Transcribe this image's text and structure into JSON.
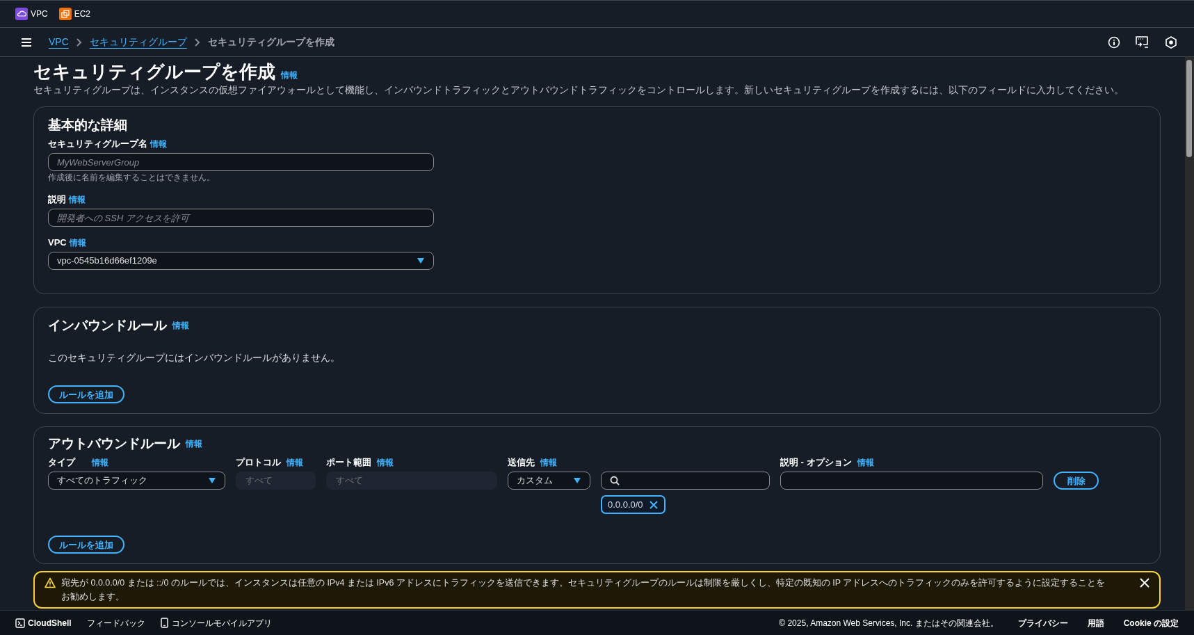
{
  "top_nav": {
    "services": [
      {
        "label": "VPC",
        "color": "#7d4cdb"
      },
      {
        "label": "EC2",
        "color": "#ed7100"
      }
    ]
  },
  "breadcrumbs": [
    {
      "label": "VPC",
      "kind": "link"
    },
    {
      "label": "セキュリティグループ",
      "kind": "link"
    },
    {
      "label": "セキュリティグループを作成",
      "kind": "current"
    }
  ],
  "header": {
    "title": "セキュリティグループを作成",
    "info": "情報",
    "description": "セキュリティグループは、インスタンスの仮想ファイアウォールとして機能し、インバウンドトラフィックとアウトバウンドトラフィックをコントロールします。新しいセキュリティグループを作成するには、以下のフィールドに入力してください。"
  },
  "basic_details": {
    "title": "基本的な詳細",
    "fields": [
      {
        "kind": "text",
        "label": "セキュリティグループ名",
        "info": "情報",
        "placeholder": "MyWebServerGroup",
        "hint": "作成後に名前を編集することはできません。"
      },
      {
        "kind": "text",
        "label": "説明",
        "info": "情報",
        "placeholder": "開発者への SSH アクセスを許可"
      },
      {
        "kind": "select",
        "label": "VPC",
        "info": "情報",
        "value": "vpc-0545b16d66ef1209e"
      }
    ]
  },
  "inbound_rules": {
    "title": "インバウンドルール",
    "info": "情報",
    "empty_message": "このセキュリティグループにはインバウンドルールがありません。",
    "add_button": "ルールを追加"
  },
  "outbound_rules": {
    "title": "アウトバウンドルール",
    "info": "情報",
    "columns": [
      {
        "label": "タイプ",
        "info": "情報"
      },
      {
        "label": "プロトコル",
        "info": "情報"
      },
      {
        "label": "ポート範囲",
        "info": "情報"
      },
      {
        "label": "送信先",
        "info": "情報"
      },
      {
        "label": "説明 - オプション",
        "info": "情報"
      }
    ],
    "rows": [
      {
        "type": "すべてのトラフィック",
        "protocol": {
          "value": "すべて",
          "disabled": true
        },
        "port_range": {
          "value": "すべて",
          "disabled": true
        },
        "destination": "カスタム",
        "destination_tokens": [
          "0.0.0.0/0"
        ],
        "delete_button": "削除"
      }
    ],
    "add_button": "ルールを追加"
  },
  "warning": {
    "message": "宛先が 0.0.0.0/0 または ::/0 のルールでは、インスタンスは任意の IPv4 または IPv6 アドレスにトラフィックを送信できます。セキュリティグループのルールは制限を厳しくし、特定の既知の IP アドレスへのトラフィックのみを許可するように設定することをお勧めします。"
  },
  "footer": {
    "left": [
      {
        "label": "CloudShell",
        "kind": "cloudshell"
      },
      {
        "label": "フィードバック",
        "kind": "plain"
      },
      {
        "label": "コンソールモバイルアプリ",
        "kind": "mobile"
      }
    ],
    "copyright": "© 2025, Amazon Web Services, Inc. またはその関連会社。",
    "links": [
      "プライバシー",
      "用語",
      "Cookie の設定"
    ]
  }
}
